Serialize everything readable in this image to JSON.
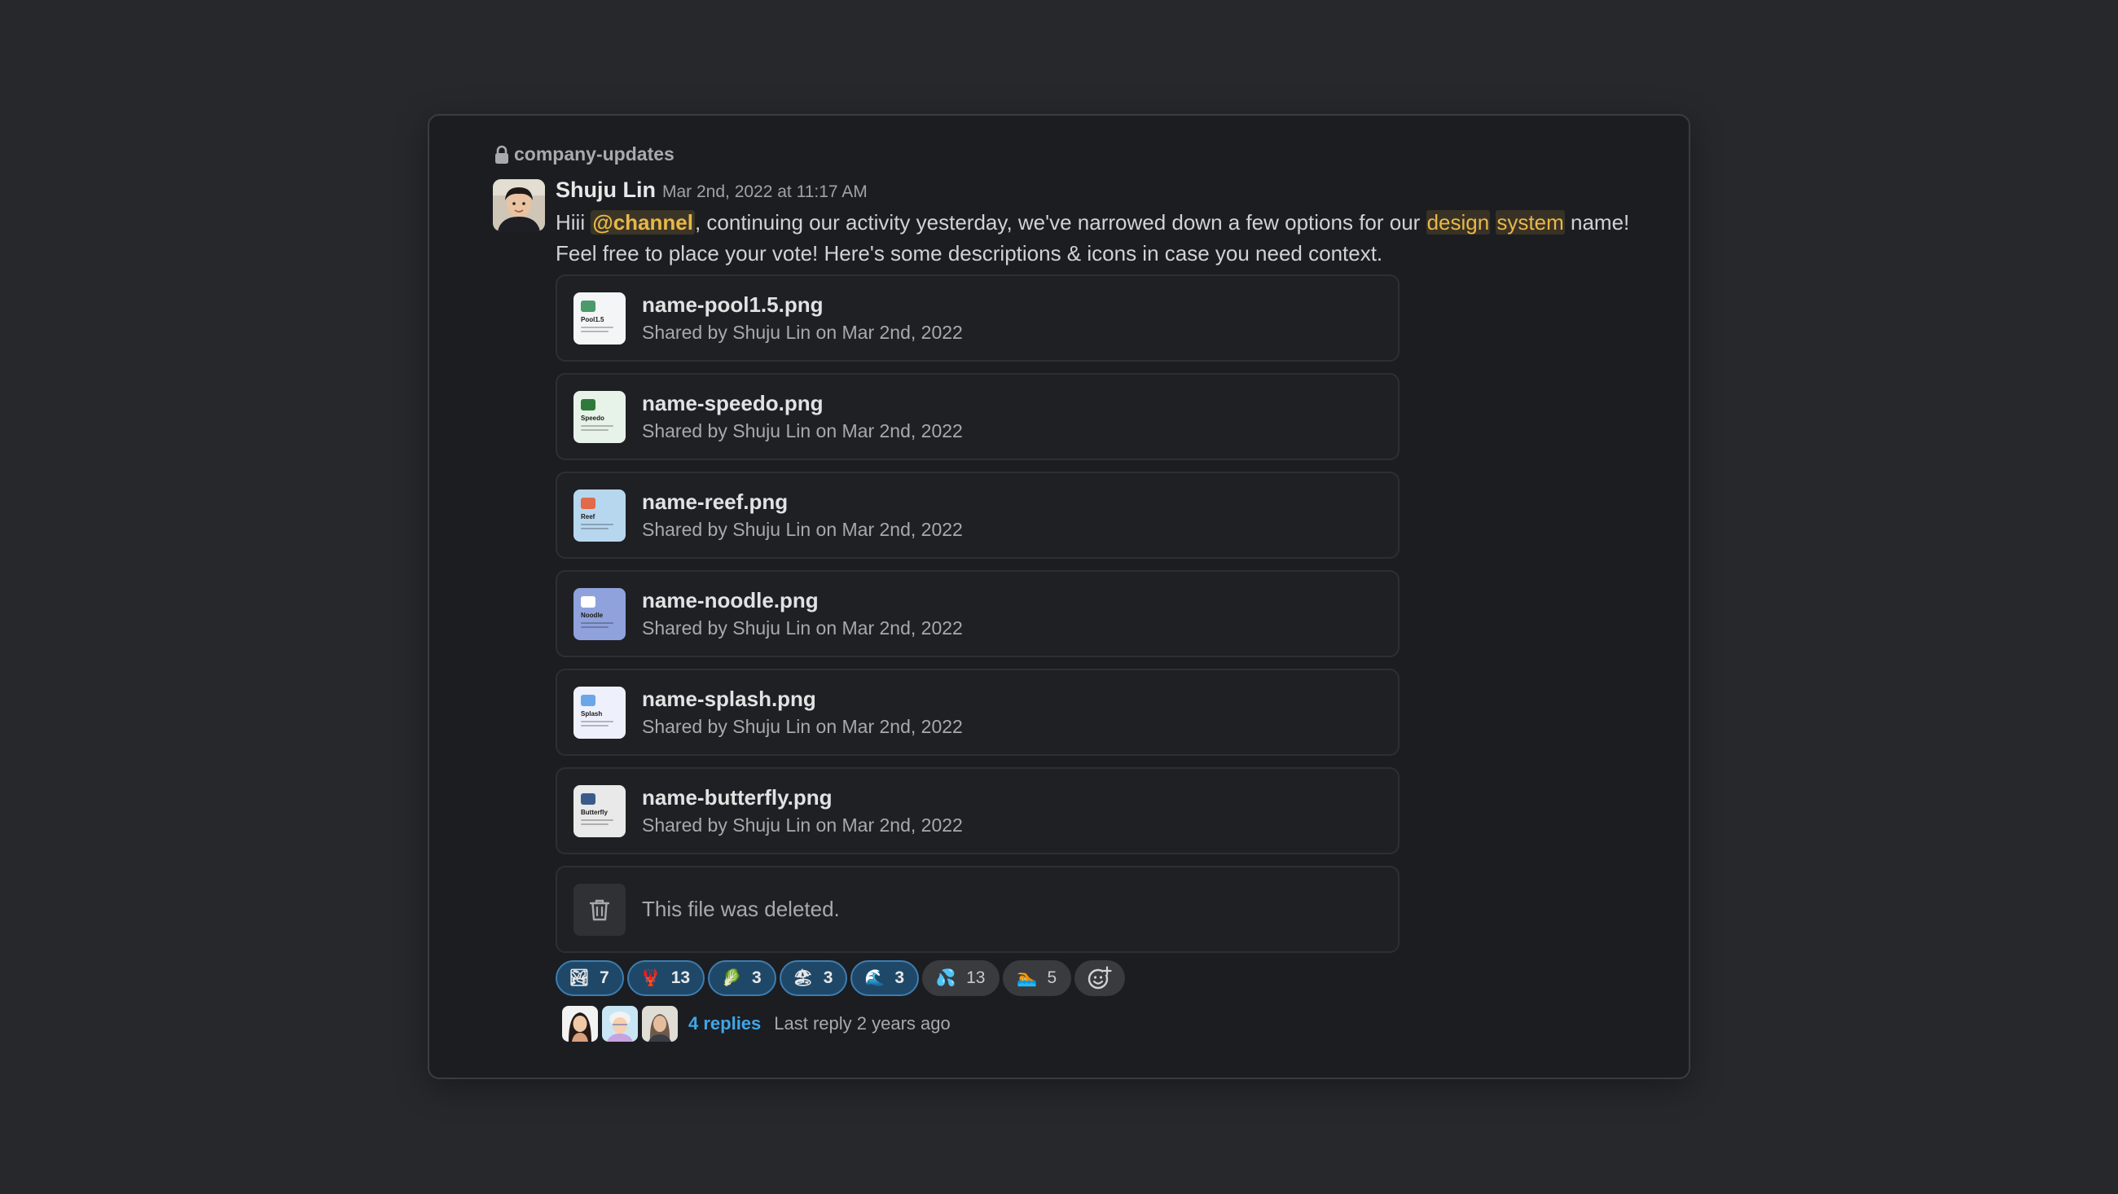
{
  "channel": {
    "name": "company-updates"
  },
  "message": {
    "author": "Shuju Lin",
    "timestamp": "Mar 2nd, 2022 at 11:17 AM",
    "text_start": "Hiii ",
    "mention": "@channel",
    "text_mid": ", continuing our activity yesterday, we've narrowed down a few options for our ",
    "highlight1": "design",
    "highlight2": "system",
    "text_end": " name!",
    "line2": "Feel free to place your vote! Here's some descriptions & icons in case you need context."
  },
  "files": [
    {
      "name": "name-pool1.5.png",
      "meta": "Shared by Shuju Lin on Mar 2nd, 2022",
      "thumb_title": "Pool1.5",
      "thumb_bg": "#f4f5f7",
      "thumb_accent": "#4a9a6a"
    },
    {
      "name": "name-speedo.png",
      "meta": "Shared by Shuju Lin on Mar 2nd, 2022",
      "thumb_title": "Speedo",
      "thumb_bg": "#e7f3e9",
      "thumb_accent": "#2f7a3a"
    },
    {
      "name": "name-reef.png",
      "meta": "Shared by Shuju Lin on Mar 2nd, 2022",
      "thumb_title": "Reef",
      "thumb_bg": "#b7d7ef",
      "thumb_accent": "#e06a4a"
    },
    {
      "name": "name-noodle.png",
      "meta": "Shared by Shuju Lin on Mar 2nd, 2022",
      "thumb_title": "Noodle",
      "thumb_bg": "#8fa2dc",
      "thumb_accent": "#ffffff"
    },
    {
      "name": "name-splash.png",
      "meta": "Shared by Shuju Lin on Mar 2nd, 2022",
      "thumb_title": "Splash",
      "thumb_bg": "#eef0fb",
      "thumb_accent": "#6aa6e8"
    },
    {
      "name": "name-butterfly.png",
      "meta": "Shared by Shuju Lin on Mar 2nd, 2022",
      "thumb_title": "Butterfly",
      "thumb_bg": "#e9e9e9",
      "thumb_accent": "#3a5a8a"
    }
  ],
  "deleted_file": {
    "text": "This file was deleted."
  },
  "reactions": [
    {
      "emoji": "🏞",
      "count": "7",
      "active": true
    },
    {
      "emoji": "🦞",
      "count": "13",
      "active": true
    },
    {
      "emoji": "🥬",
      "count": "3",
      "active": true
    },
    {
      "emoji": "🏖",
      "count": "3",
      "active": true
    },
    {
      "emoji": "🌊",
      "count": "3",
      "active": true
    },
    {
      "emoji": "💦",
      "count": "13",
      "active": false
    },
    {
      "emoji": "🏊",
      "count": "5",
      "active": false
    }
  ],
  "thread": {
    "replies": "4 replies",
    "last_reply": "Last reply 2 years ago"
  },
  "colors": {
    "accent_link": "#3fa6e8",
    "mention": "#e8b74a",
    "reaction_active": "#1f4868"
  }
}
